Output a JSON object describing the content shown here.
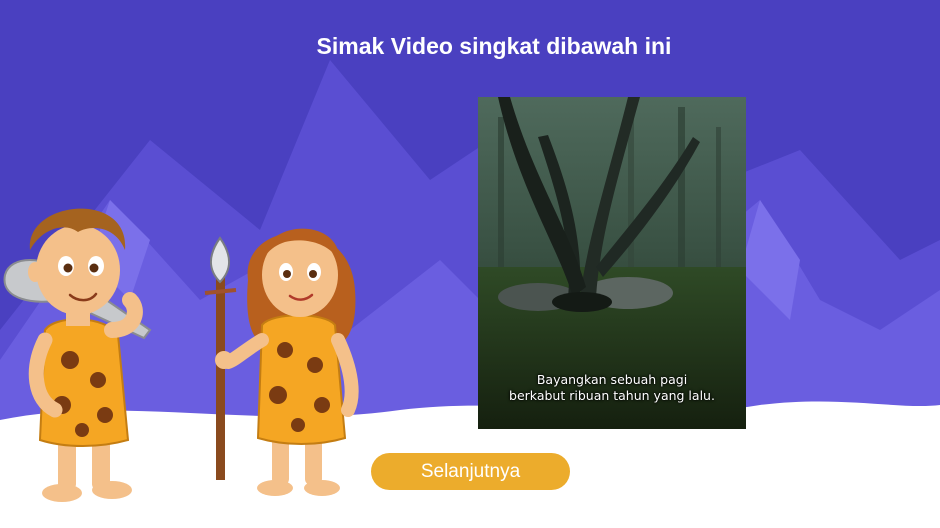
{
  "page": {
    "title": "Simak Video singkat dibawah ini"
  },
  "video": {
    "subtitle_line1": "Bayangkan sebuah pagi",
    "subtitle_line2": "berkabut ribuan tahun yang lalu."
  },
  "next_button": {
    "label": "Selanjutnya"
  },
  "colors": {
    "sky": "#4a40c0",
    "mountains": "#6a5ee0",
    "snow": "#ffffff",
    "button": "#ecac2c",
    "leopard_dress": "#f5a623"
  },
  "illustrations": [
    "caveman-with-club",
    "cavewoman-with-spear"
  ]
}
